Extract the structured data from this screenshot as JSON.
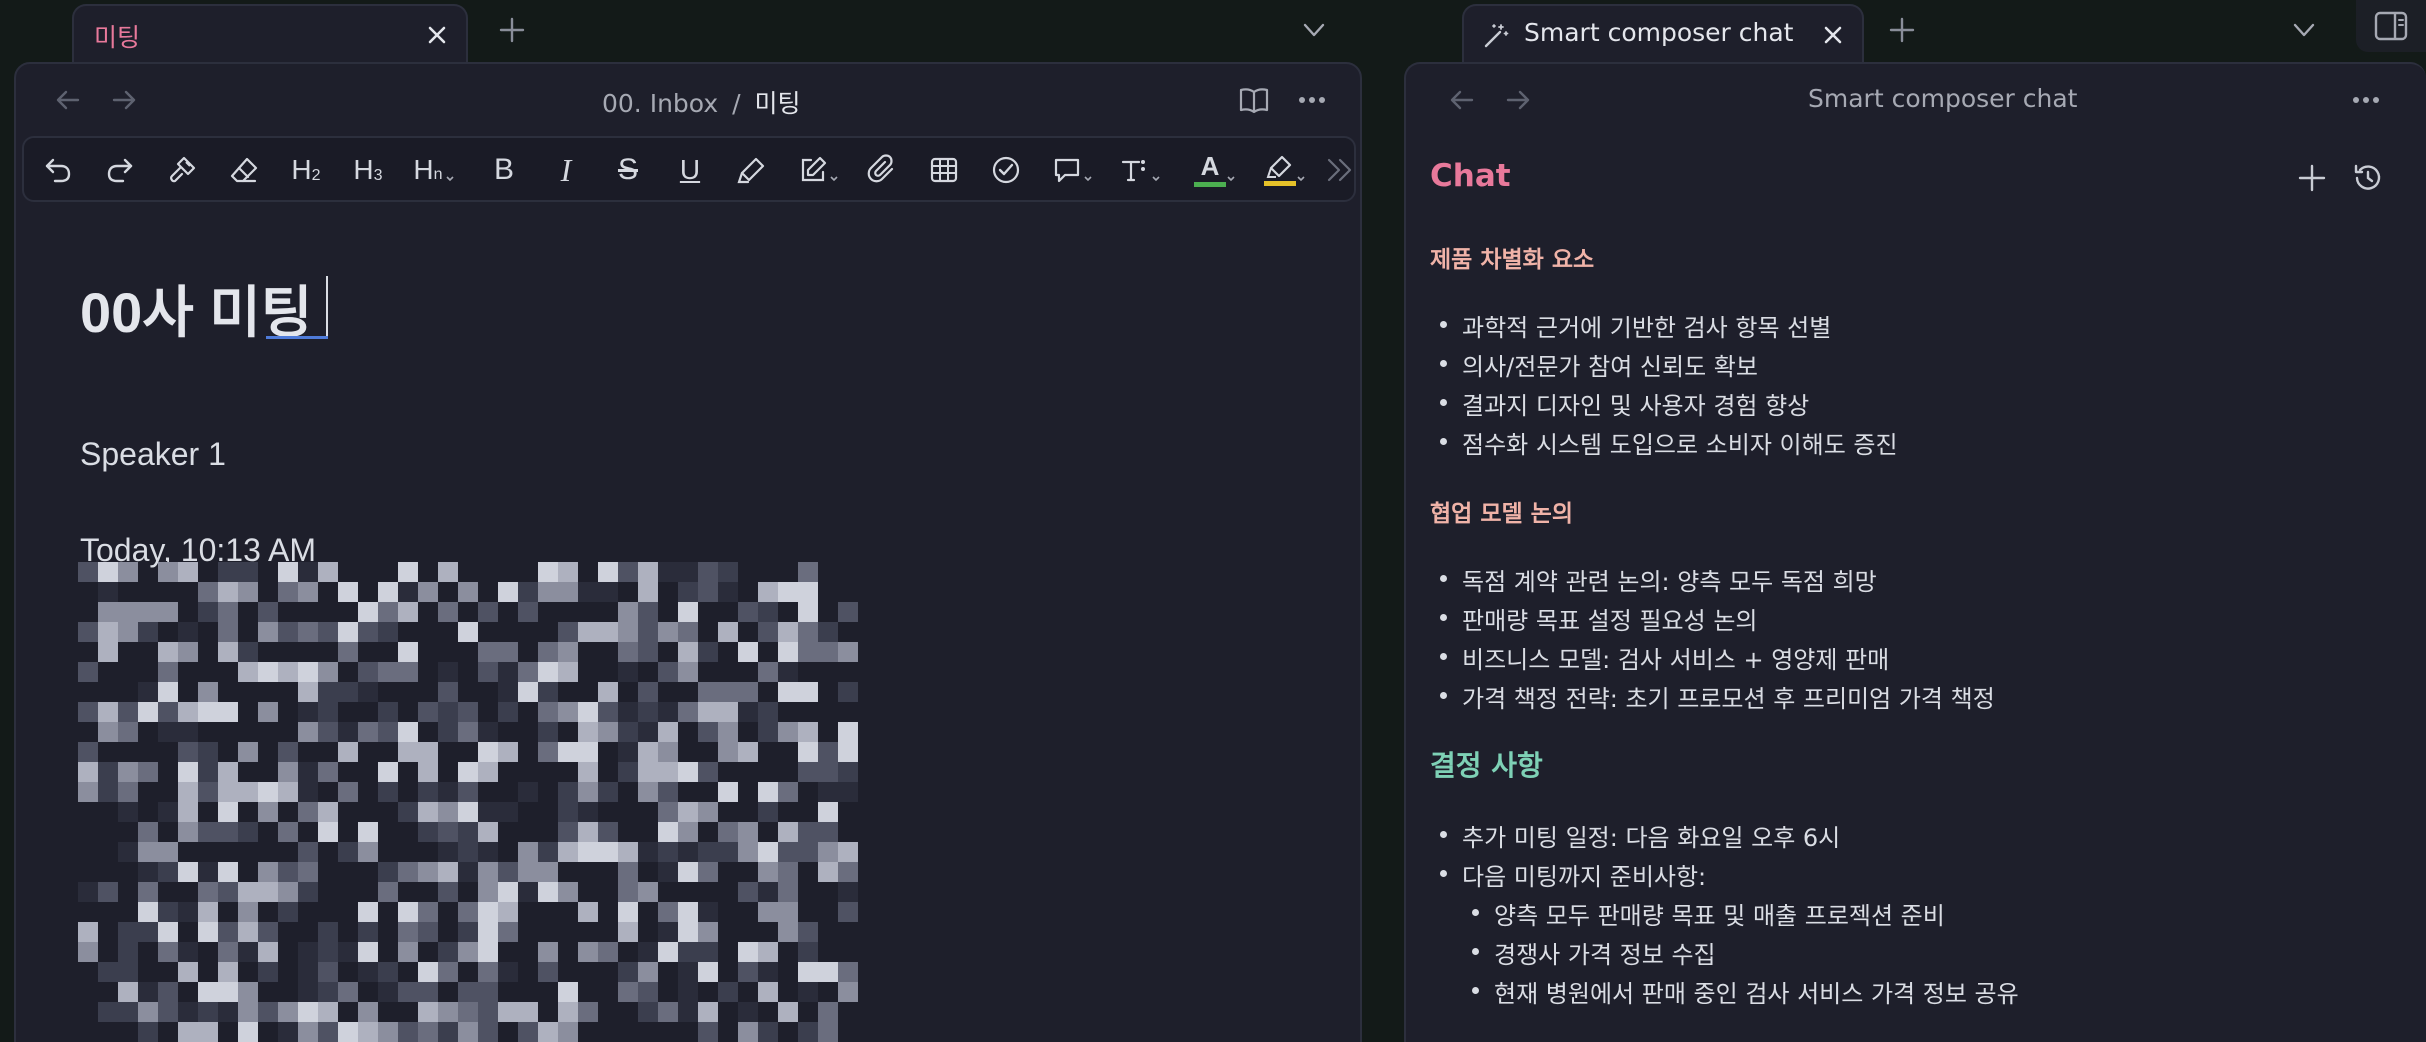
{
  "left_tab": {
    "label": "미팅"
  },
  "right_tab": {
    "label": "Smart composer chat"
  },
  "editor": {
    "breadcrumb_folder": "00. Inbox",
    "breadcrumb_sep": "/",
    "breadcrumb_file": "미팅",
    "toolbar": {
      "h2": "H",
      "h2_sub": "2",
      "h3": "H",
      "h3_sub": "3",
      "hn": "H",
      "hn_sub": "n",
      "bold": "B",
      "italic": "I",
      "strike": "S",
      "underline": "U",
      "font_color": "A",
      "colors": {
        "font_color_bar": "#4caf50",
        "highlight_bar": "#e6c229"
      }
    },
    "title": "00사 미팅",
    "speaker": "Speaker 1",
    "timestamp": "Today, 10:13 AM"
  },
  "chat": {
    "nav_title": "Smart composer chat",
    "heading": "Chat",
    "section1_title": "제품 차별화 요소",
    "section1_items": [
      "과학적 근거에 기반한 검사 항목 선별",
      "의사/전문가 참여 신뢰도 확보",
      "결과지 디자인 및 사용자 경험 향상",
      "점수화 시스템 도입으로 소비자 이해도 증진"
    ],
    "section2_title": "협업 모델 논의",
    "section2_items": [
      "독점 계약 관련 논의: 양측 모두 독점 희망",
      "판매량 목표 설정 필요성 논의",
      "비즈니스 모델: 검사 서비스 + 영양제 판매",
      "가격 책정 전략: 초기 프로모션 후 프리미엄 가격 책정"
    ],
    "section3_title": "결정 사항",
    "section3_items": [
      "추가 미팅 일정: 다음 화요일 오후 6시",
      "다음 미팅까지 준비사항:"
    ],
    "section3_subitems": [
      "양측 모두 판매량 목표 및 매출 프로젝션 준비",
      "경쟁사 가격 정보 수집",
      "현재 병원에서 판매 중인 검사 서비스 가격 정보 공유"
    ]
  },
  "colors": {
    "background": "#131a18",
    "panel": "#1e1f2b",
    "tab_label_accent": "#e8799b",
    "chat_heading": "#e8799b",
    "section_heading": "#f0b3a8",
    "decision_heading": "#7ed1b6"
  }
}
